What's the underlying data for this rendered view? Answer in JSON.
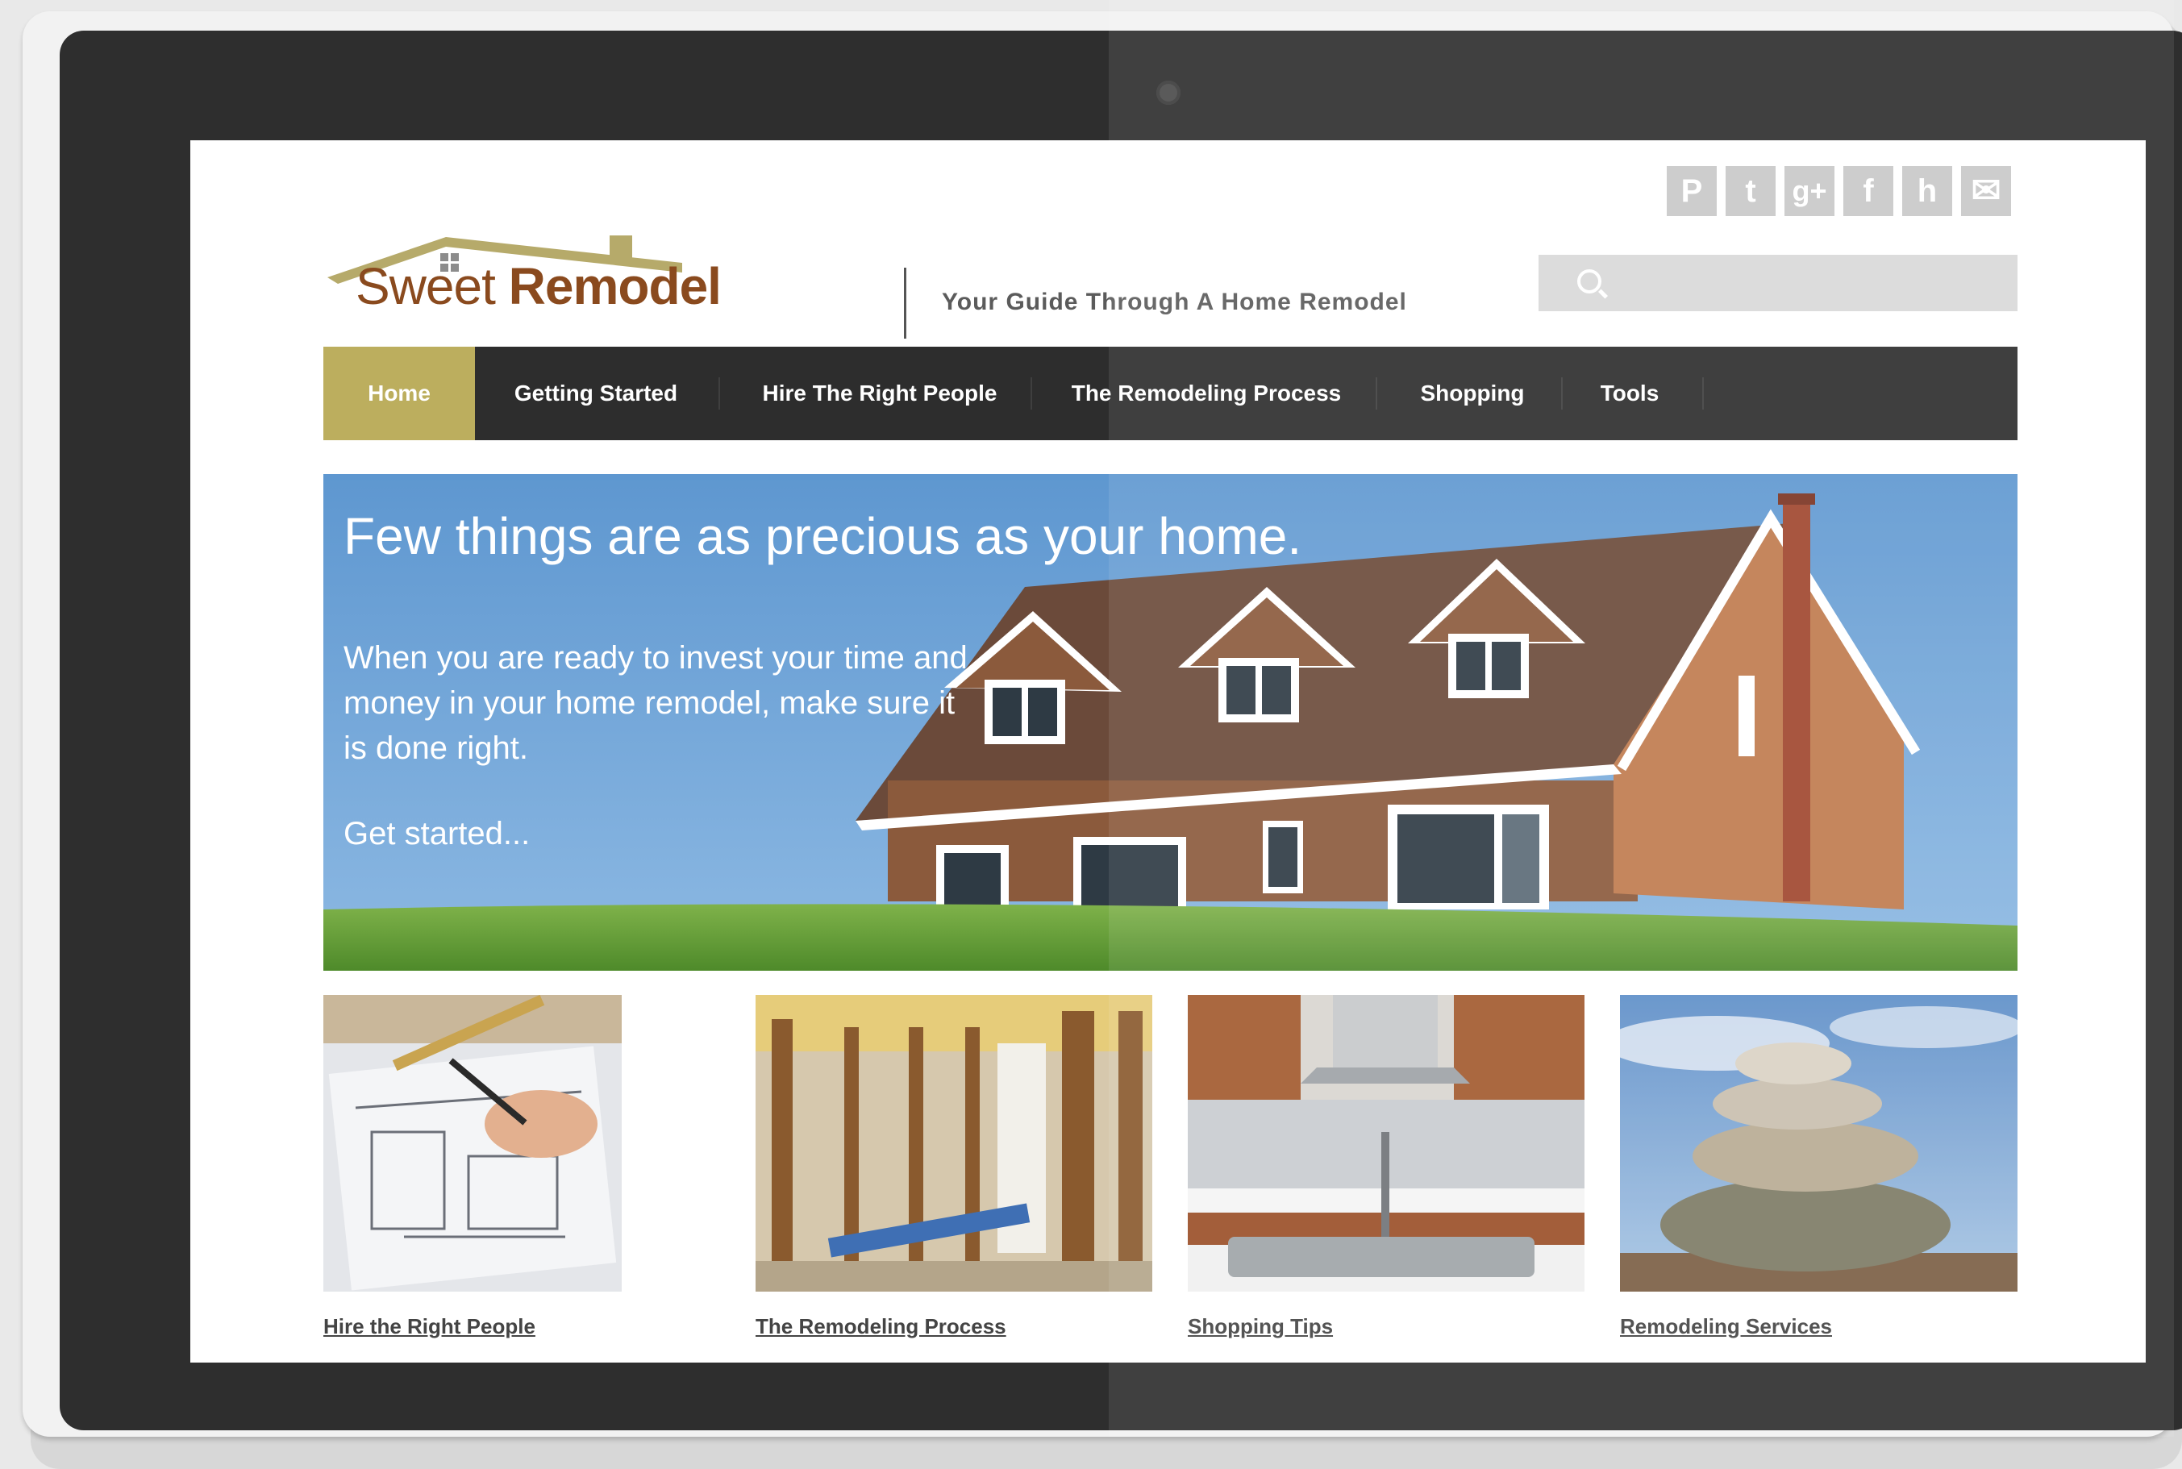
{
  "site": {
    "logo": {
      "word1": "Sweet",
      "word2": "Remodel"
    },
    "tagline": "Your Guide Through A Home Remodel"
  },
  "social": [
    {
      "name": "pinterest-icon",
      "glyph": "P"
    },
    {
      "name": "twitter-icon",
      "glyph": "t"
    },
    {
      "name": "google-plus-icon",
      "glyph": "g+"
    },
    {
      "name": "facebook-icon",
      "glyph": "f"
    },
    {
      "name": "houzz-icon",
      "glyph": "h"
    },
    {
      "name": "email-icon",
      "glyph": "✉"
    }
  ],
  "search": {
    "placeholder": ""
  },
  "nav": {
    "items": [
      {
        "label": "Home",
        "active": true
      },
      {
        "label": "Getting Started",
        "active": false
      },
      {
        "label": "Hire The Right People",
        "active": false
      },
      {
        "label": "The Remodeling Process",
        "active": false
      },
      {
        "label": "Shopping",
        "active": false
      },
      {
        "label": "Tools",
        "active": false
      }
    ]
  },
  "hero": {
    "title": "Few things are as precious as your home.",
    "body": "When you are ready to invest your time and money in your home remodel, make sure it is done right.",
    "cta": "Get started..."
  },
  "features": [
    {
      "label": "Hire the Right People"
    },
    {
      "label": "The Remodeling Process"
    },
    {
      "label": "Shopping Tips"
    },
    {
      "label": "Remodeling Services"
    }
  ],
  "colors": {
    "nav_active": "#bcae5e",
    "nav_bg": "#2d2d2d",
    "logo_brown": "#8a4a1e",
    "sky": "#6fa2d6"
  }
}
